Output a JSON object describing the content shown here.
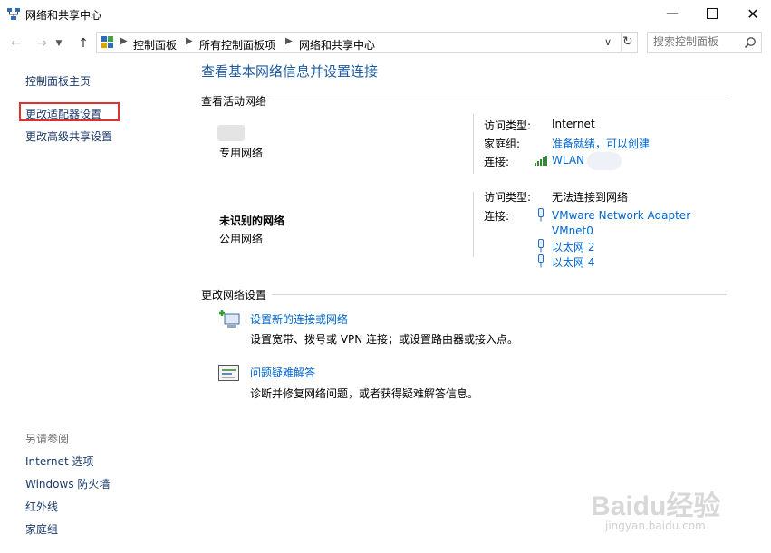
{
  "window": {
    "title": "网络和共享中心"
  },
  "address": {
    "crumbs": [
      "控制面板",
      "所有控制面板项",
      "网络和共享中心"
    ],
    "search_placeholder": "搜索控制面板"
  },
  "sidebar": {
    "top_links": [
      "控制面板主页",
      "更改适配器设置",
      "更改高级共享设置"
    ],
    "see_also_title": "另请参阅",
    "see_also_links": [
      "Internet 选项",
      "Windows 防火墙",
      "红外线",
      "家庭组"
    ]
  },
  "main": {
    "title": "查看基本网络信息并设置连接",
    "active_networks_header": "查看活动网络",
    "network1": {
      "type_label": "专用网络",
      "access_type_label": "访问类型:",
      "access_type_value": "Internet",
      "homegroup_label": "家庭组:",
      "homegroup_value": "准备就绪，可以创建",
      "connection_label": "连接:",
      "connection_value": "WLAN"
    },
    "network2": {
      "name": "未识别的网络",
      "type_label": "公用网络",
      "access_type_label": "访问类型:",
      "access_type_value": "无法连接到网络",
      "connection_label": "连接:",
      "connections": [
        "VMware Network Adapter VMnet0",
        "以太网 2",
        "以太网 4"
      ]
    },
    "change_settings_header": "更改网络设置",
    "tasks": [
      {
        "title": "设置新的连接或网络",
        "desc": "设置宽带、拨号或 VPN 连接；或设置路由器或接入点。"
      },
      {
        "title": "问题疑难解答",
        "desc": "诊断并修复网络问题，或者获得疑难解答信息。"
      }
    ]
  },
  "watermark": {
    "brand": "Baidu经验",
    "url": "jingyan.baidu.com"
  }
}
